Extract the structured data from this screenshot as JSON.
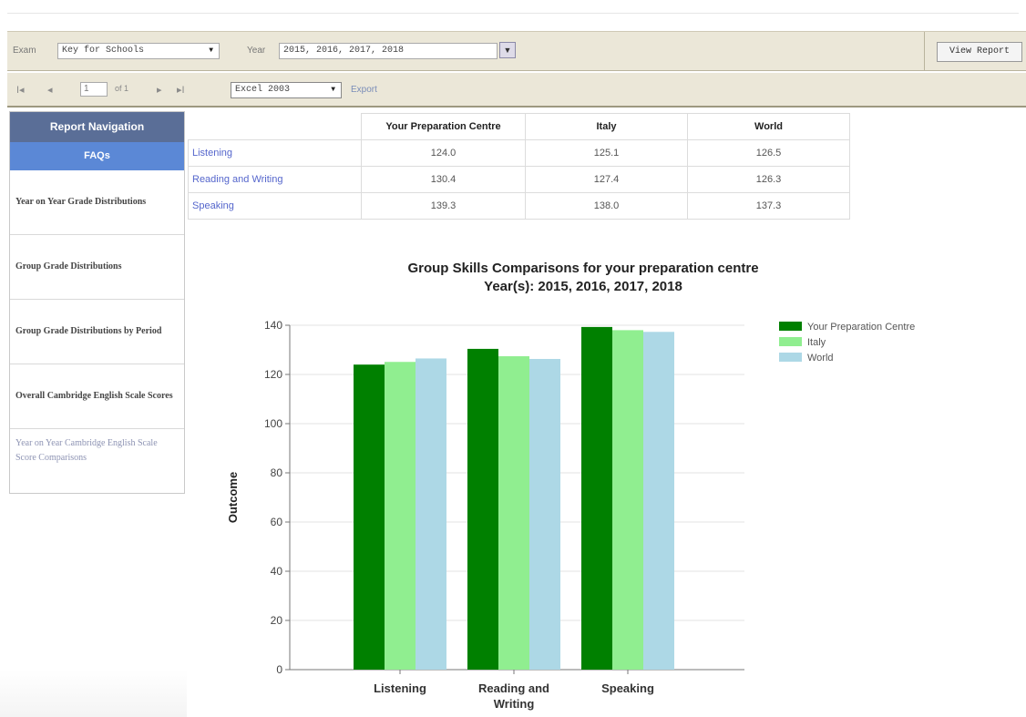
{
  "toolbar": {
    "exam_label": "Exam",
    "exam_value": "Key for Schools",
    "year_label": "Year",
    "year_value": "2015, 2016, 2017, 2018",
    "view_report": "View Report"
  },
  "report_toolbar": {
    "first": "I◂",
    "prev": "◂",
    "page": "1",
    "of_pages": "of 1",
    "next": "▸",
    "last": "▸I",
    "format_value": "Excel 2003",
    "export": "Export"
  },
  "sidebar": {
    "title": "Report Navigation",
    "faqs": "FAQs",
    "items": [
      {
        "label": "Year on Year Grade Distributions"
      },
      {
        "label": "Group Grade Distributions"
      },
      {
        "label": "Group Grade Distributions by Period"
      },
      {
        "label": "Overall Cambridge English Scale Scores"
      },
      {
        "label": "Year on Year Cambridge English Scale Score Comparisons"
      }
    ]
  },
  "table": {
    "headers": [
      "",
      "Your Preparation Centre",
      "Italy",
      "World"
    ],
    "rows": [
      {
        "label": "Listening",
        "values": [
          "124.0",
          "125.1",
          "126.5"
        ]
      },
      {
        "label": "Reading and Writing",
        "values": [
          "130.4",
          "127.4",
          "126.3"
        ]
      },
      {
        "label": "Speaking",
        "values": [
          "139.3",
          "138.0",
          "137.3"
        ]
      }
    ]
  },
  "chart_data": {
    "type": "bar",
    "title": "Group Skills Comparisons for your preparation centre",
    "subtitle": "Year(s): 2015, 2016, 2017, 2018",
    "categories": [
      "Listening",
      "Reading and Writing",
      "Speaking"
    ],
    "series": [
      {
        "name": "Your Preparation Centre",
        "values": [
          124.0,
          130.4,
          139.3
        ],
        "color": "#008000"
      },
      {
        "name": "Italy",
        "values": [
          125.1,
          127.4,
          138.0
        ],
        "color": "#90ee90"
      },
      {
        "name": "World",
        "values": [
          126.5,
          126.3,
          137.3
        ],
        "color": "#add8e6"
      }
    ],
    "ylabel": "Outcome",
    "xlabel": "",
    "ylim": [
      0,
      140
    ],
    "yticks": [
      0,
      20,
      40,
      60,
      80,
      100,
      120,
      140
    ],
    "grid": true,
    "legend": "top-right"
  }
}
